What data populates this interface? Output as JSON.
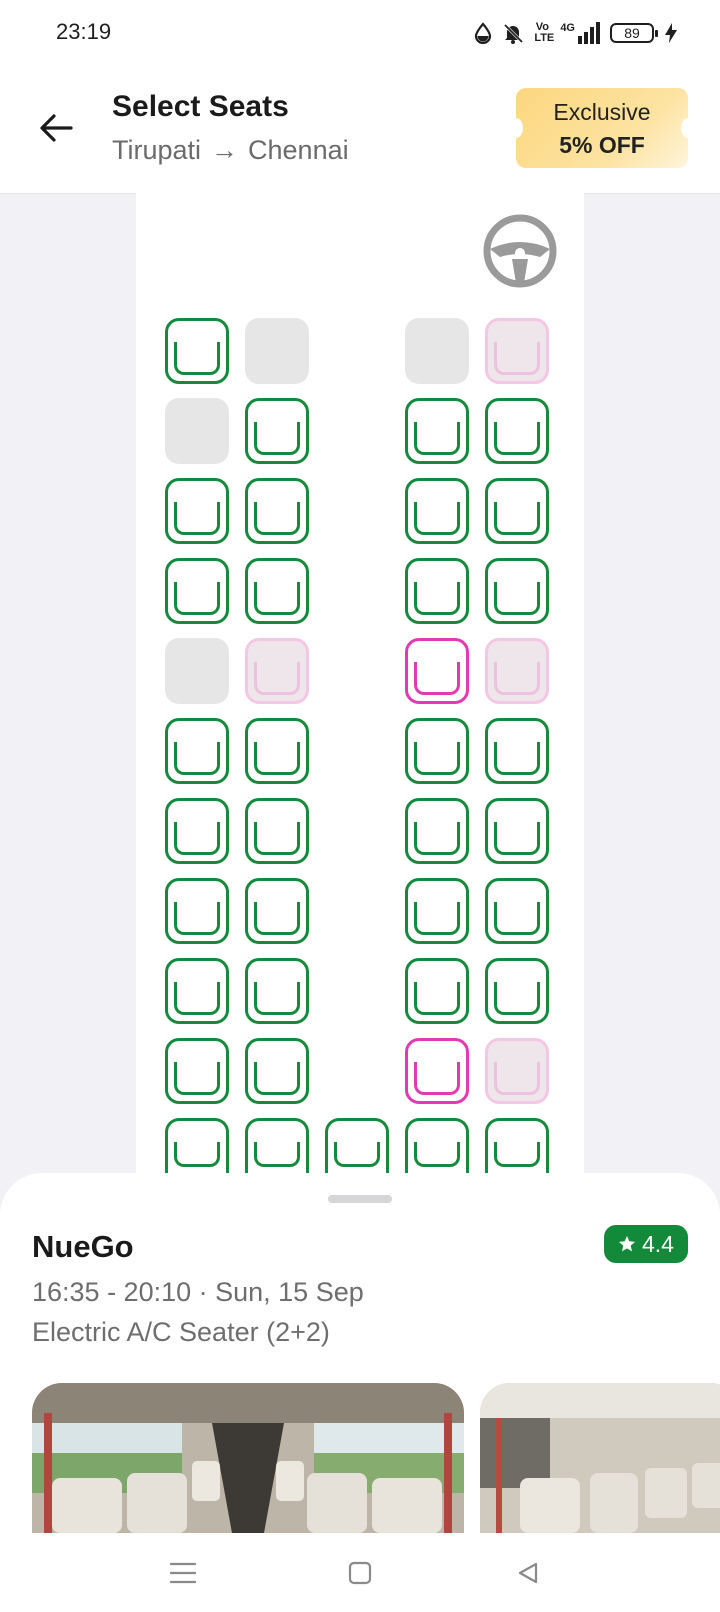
{
  "status_bar": {
    "time": "23:19",
    "network_label": "4G",
    "volte_label": "Vo LTE",
    "battery": "89"
  },
  "header": {
    "title": "Select Seats",
    "origin": "Tirupati",
    "destination": "Chennai",
    "arrow": "→",
    "offer_line1": "Exclusive",
    "offer_line2": "5% OFF"
  },
  "seat_legend_colors": {
    "available": "#158a3c",
    "booked": "#e6e6e6",
    "ladies_available": "#e03bb0",
    "ladies_booked": "#f4c7e6"
  },
  "seat_rows": [
    [
      "available",
      "booked",
      null,
      "booked",
      "ladies-booked"
    ],
    [
      "booked",
      "available",
      null,
      "available",
      "available"
    ],
    [
      "available",
      "available",
      null,
      "available",
      "available"
    ],
    [
      "available",
      "available",
      null,
      "available",
      "available"
    ],
    [
      "booked",
      "ladies-booked",
      null,
      "ladies",
      "ladies-booked"
    ],
    [
      "available",
      "available",
      null,
      "available",
      "available"
    ],
    [
      "available",
      "available",
      null,
      "available",
      "available"
    ],
    [
      "available",
      "available",
      null,
      "available",
      "available"
    ],
    [
      "available",
      "available",
      null,
      "available",
      "available"
    ],
    [
      "available",
      "available",
      null,
      "ladies",
      "ladies-booked"
    ],
    [
      "available",
      "available",
      "available",
      "available",
      "available"
    ]
  ],
  "bus": {
    "operator": "NueGo",
    "rating": "4.4",
    "timing": "16:35 - 20:10 · Sun, 15 Sep",
    "type": "Electric A/C Seater (2+2)"
  },
  "nav": {
    "menu_icon": "menu-icon",
    "home_icon": "home-square-icon",
    "back_icon": "back-triangle-icon"
  }
}
